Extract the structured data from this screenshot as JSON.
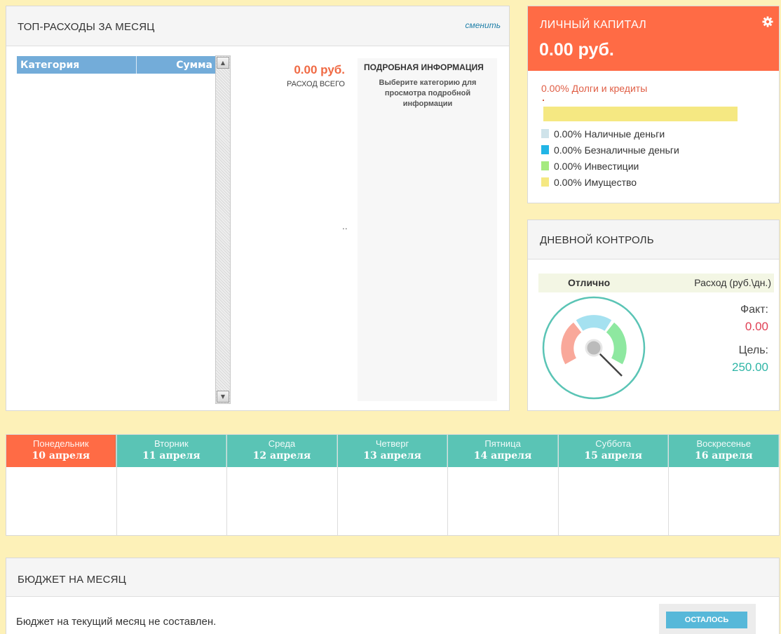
{
  "top_expenses": {
    "title": "ТОП-РАСХОДЫ ЗА МЕСЯЦ",
    "change_link": "сменить",
    "table": {
      "columns": [
        "Категория",
        "Сумма"
      ],
      "rows": []
    },
    "total_amount": "0.00 руб.",
    "total_label": "РАСХОД ВСЕГО",
    "dots": "..",
    "detail": {
      "title": "ПОДРОБНАЯ ИНФОРМАЦИЯ",
      "text": "Выберите категорию для просмотра подробной информации"
    },
    "scroll_up_icon": "arrow-up-icon",
    "scroll_down_icon": "arrow-down-icon"
  },
  "capital": {
    "title": "ЛИЧНЫЙ КАПИТАЛ",
    "value": "0.00 руб.",
    "settings_icon": "gear-icon",
    "debts": "0.00% Долги и кредиты",
    "bar_color": "#f5e882",
    "legend": [
      {
        "label": "0.00% Наличные деньги",
        "color": "#cfe3ea"
      },
      {
        "label": "0.00% Безналичные деньги",
        "color": "#22b5e6"
      },
      {
        "label": "0.00% Инвестиции",
        "color": "#a6ea7f"
      },
      {
        "label": "0.00% Имущество",
        "color": "#f5e882"
      }
    ],
    "accent_color": "#ff6b45"
  },
  "daily_control": {
    "title": "ДНЕВНОЙ КОНТРОЛЬ",
    "status": "Отлично",
    "unit": "Расход (руб.\\дн.)",
    "fact_label": "Факт:",
    "fact_value": "0.00",
    "goal_label": "Цель:",
    "goal_value": "250.00",
    "gauge_colors": {
      "low": "#f9a89a",
      "mid": "#a5e1f0",
      "high": "#8ee8a0",
      "ring": "#5ac4b5"
    }
  },
  "week": {
    "days": [
      {
        "name": "Понедельник",
        "date": "10 апреля",
        "today": true
      },
      {
        "name": "Вторник",
        "date": "11 апреля",
        "today": false
      },
      {
        "name": "Среда",
        "date": "12 апреля",
        "today": false
      },
      {
        "name": "Четверг",
        "date": "13 апреля",
        "today": false
      },
      {
        "name": "Пятница",
        "date": "14 апреля",
        "today": false
      },
      {
        "name": "Суббота",
        "date": "15 апреля",
        "today": false
      },
      {
        "name": "Воскресенье",
        "date": "16 апреля",
        "today": false
      }
    ],
    "header_color": "#5ac4b5",
    "today_color": "#ff6b45"
  },
  "budget": {
    "title": "БЮДЖЕТ НА МЕСЯЦ",
    "text": "Бюджет на текущий месяц не составлен.",
    "remaining_button": "ОСТАЛОСЬ"
  }
}
